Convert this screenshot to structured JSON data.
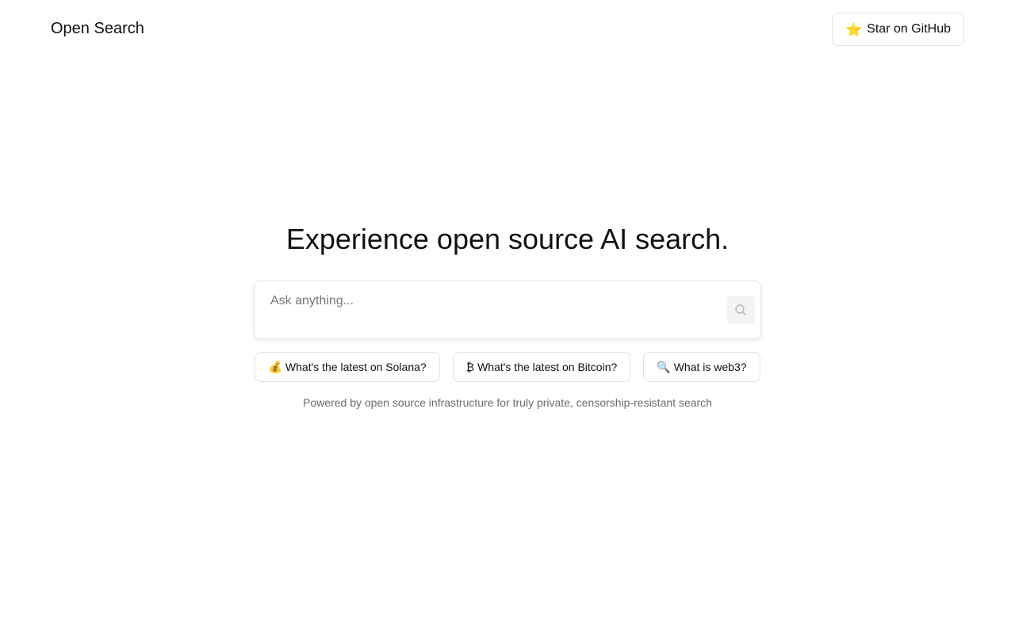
{
  "header": {
    "brand": "Open Search",
    "github_button": {
      "icon": "⭐",
      "label": "Star on GitHub"
    }
  },
  "main": {
    "headline": "Experience open source AI search.",
    "search": {
      "placeholder": "Ask anything...",
      "value": ""
    },
    "suggestions": [
      {
        "icon": "💰",
        "label": "What's the latest on Solana?"
      },
      {
        "icon": "₿",
        "label": "What's the latest on Bitcoin?"
      },
      {
        "icon": "🔍",
        "label": "What is web3?"
      }
    ],
    "footer_note": "Powered by open source infrastructure for truly private, censorship-resistant search"
  },
  "colors": {
    "text": "#111111",
    "muted": "#6b6b6b",
    "border": "#e2e2e2",
    "submit_bg": "#f4f4f4"
  }
}
